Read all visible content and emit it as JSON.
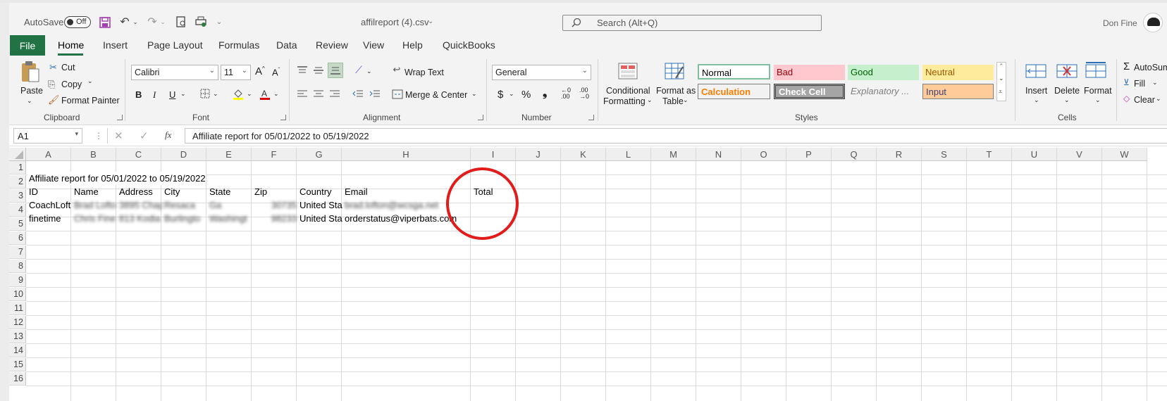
{
  "titlebar": {
    "autosave_label": "AutoSave",
    "autosave_state": "Off",
    "filename": "affilreport (4).csv",
    "search_placeholder": "Search (Alt+Q)",
    "user_name": "Don Fine"
  },
  "tabs": [
    "File",
    "Home",
    "Insert",
    "Page Layout",
    "Formulas",
    "Data",
    "Review",
    "View",
    "Help",
    "QuickBooks"
  ],
  "clipboard": {
    "paste": "Paste",
    "cut": "Cut",
    "copy": "Copy",
    "format_painter": "Format Painter",
    "group": "Clipboard"
  },
  "font": {
    "name": "Calibri",
    "size": "11",
    "group": "Font"
  },
  "alignment": {
    "wrap": "Wrap Text",
    "merge": "Merge & Center",
    "group": "Alignment"
  },
  "number": {
    "format": "General",
    "group": "Number"
  },
  "styles": {
    "conditional": "Conditional",
    "conditional2": "Formatting",
    "format_table": "Format as",
    "format_table2": "Table",
    "cells": [
      {
        "label": "Normal",
        "bg": "#ffffff",
        "fg": "#000000",
        "border": "#7fbf9f"
      },
      {
        "label": "Bad",
        "bg": "#ffc7ce",
        "fg": "#9c0006"
      },
      {
        "label": "Good",
        "bg": "#c6efce",
        "fg": "#006100"
      },
      {
        "label": "Neutral",
        "bg": "#ffeb9c",
        "fg": "#9c5700"
      },
      {
        "label": "Calculation",
        "bg": "#f2f2f2",
        "fg": "#fa7d00",
        "border": "#7f7f7f"
      },
      {
        "label": "Check Cell",
        "bg": "#a5a5a5",
        "fg": "#ffffff",
        "border": "#3f3f3f"
      },
      {
        "label": "Explanatory ...",
        "bg": "#f3f3f3",
        "fg": "#7f7f7f"
      },
      {
        "label": "Input",
        "bg": "#ffcc99",
        "fg": "#3f3f76",
        "border": "#7f7f7f"
      }
    ],
    "group": "Styles"
  },
  "cells_group": {
    "insert": "Insert",
    "delete": "Delete",
    "format": "Format",
    "group": "Cells"
  },
  "editing": {
    "autosum": "AutoSum",
    "fill": "Fill",
    "clear": "Clear"
  },
  "formula_bar": {
    "name_box": "A1",
    "formula": "Affiliate report for 05/01/2022 to 05/19/2022"
  },
  "columns": [
    "A",
    "B",
    "C",
    "D",
    "E",
    "F",
    "G",
    "H",
    "I",
    "J",
    "K",
    "L",
    "M",
    "N",
    "O",
    "P",
    "Q",
    "R",
    "S",
    "T",
    "U",
    "V",
    "W"
  ],
  "rows": [
    "1",
    "2",
    "3",
    "4",
    "5",
    "6",
    "7",
    "8",
    "9",
    "10",
    "11",
    "12",
    "13",
    "14",
    "15",
    "16"
  ],
  "sheet": {
    "r1": "Affiliate report for 05/01/2022 to 05/19/2022",
    "headers": [
      "ID",
      "Name",
      "Address",
      "City",
      "State",
      "Zip",
      "Country",
      "Email",
      "Total"
    ],
    "r3": [
      "CoachLoft",
      "Brad Lofto",
      "3895 Chap",
      "Resaca",
      "Ga",
      "30735",
      "United Sta",
      "brad.lofton@wcsga.net"
    ],
    "r4": [
      "finetime",
      "Chris Fine",
      "813 Kodia",
      "Burlingto",
      "Washingt",
      "98233",
      "United Sta",
      "orderstatus@viperbats.com"
    ]
  },
  "annotation_color": "#e21b1b"
}
